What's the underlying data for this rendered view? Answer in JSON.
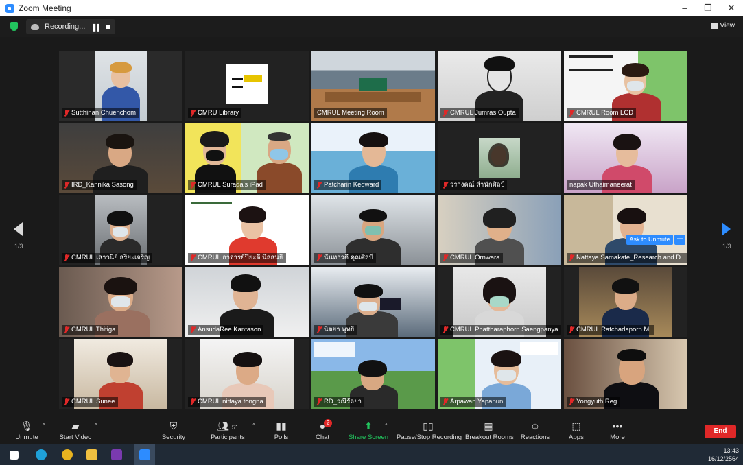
{
  "window": {
    "title": "Zoom Meeting",
    "controls": [
      "–",
      "❐",
      "✕"
    ]
  },
  "topbar": {
    "recording_label": "Recording...",
    "view_label": "View"
  },
  "pagination": {
    "left": "1/3",
    "right": "1/3"
  },
  "participants": [
    {
      "name": "Sutthinan Chuenchom",
      "muted": true
    },
    {
      "name": "CMRU Library",
      "muted": true
    },
    {
      "name": "CMRUL Meeting Room",
      "muted": false
    },
    {
      "name": "CMRUL Jumras Oupta",
      "muted": true
    },
    {
      "name": "CMRUL Room LCD",
      "muted": true
    },
    {
      "name": "IRD_Kannika Sasong",
      "muted": true
    },
    {
      "name": "CMRUL Surada's iPad",
      "muted": true,
      "active": true
    },
    {
      "name": "Patcharin Kedward",
      "muted": true
    },
    {
      "name": "วรางคณ์ สำนักศิลป์",
      "muted": true
    },
    {
      "name": "napak Uthaimaneerat",
      "muted": false
    },
    {
      "name": "CMRUL เสาวนีย์ สริยะเจริญ",
      "muted": true
    },
    {
      "name": "CMRUL อาจารย์ปิยะดี นิลสนธิ",
      "muted": true
    },
    {
      "name": "นันทาวดี คุณศิลป์",
      "muted": true
    },
    {
      "name": "CMRUL Ornwara",
      "muted": true
    },
    {
      "name": "Nattaya Samakate_Research and D...",
      "muted": true
    },
    {
      "name": "CMRUL Thitiga",
      "muted": true
    },
    {
      "name": "AnsudaRee Kantason",
      "muted": true
    },
    {
      "name": "นิตยา พุทธิ",
      "muted": true
    },
    {
      "name": "CMRUL Phattharaphorn Saengpanya",
      "muted": true
    },
    {
      "name": "CMRUL Ratchadaporn M.",
      "muted": true
    },
    {
      "name": "CMRUL Sunee",
      "muted": true
    },
    {
      "name": "CMRUL nittaya tongna",
      "muted": true
    },
    {
      "name": "RD_วณีรัลยา",
      "muted": true
    },
    {
      "name": "Arpawan Yapanun",
      "muted": true
    },
    {
      "name": "Yongyuth Reg",
      "muted": true
    }
  ],
  "tile_overlay": {
    "ask_unmute": "Ask to Unmute",
    "more": "···"
  },
  "toolbar": {
    "unmute": "Unmute",
    "start_video": "Start Video",
    "security": "Security",
    "participants": "Participants",
    "participants_count": "51",
    "polls": "Polls",
    "chat": "Chat",
    "chat_badge": "2",
    "share_screen": "Share Screen",
    "pause_recording": "Pause/Stop Recording",
    "breakout_rooms": "Breakout Rooms",
    "reactions": "Reactions",
    "apps": "Apps",
    "more": "More",
    "end": "End"
  },
  "taskbar": {
    "time": "13:43",
    "date": "16/12/2564"
  },
  "colors": {
    "accent": "#2d8cff",
    "danger": "#e02828",
    "active_outline": "#f5d94a",
    "share_green": "#22c55e"
  }
}
